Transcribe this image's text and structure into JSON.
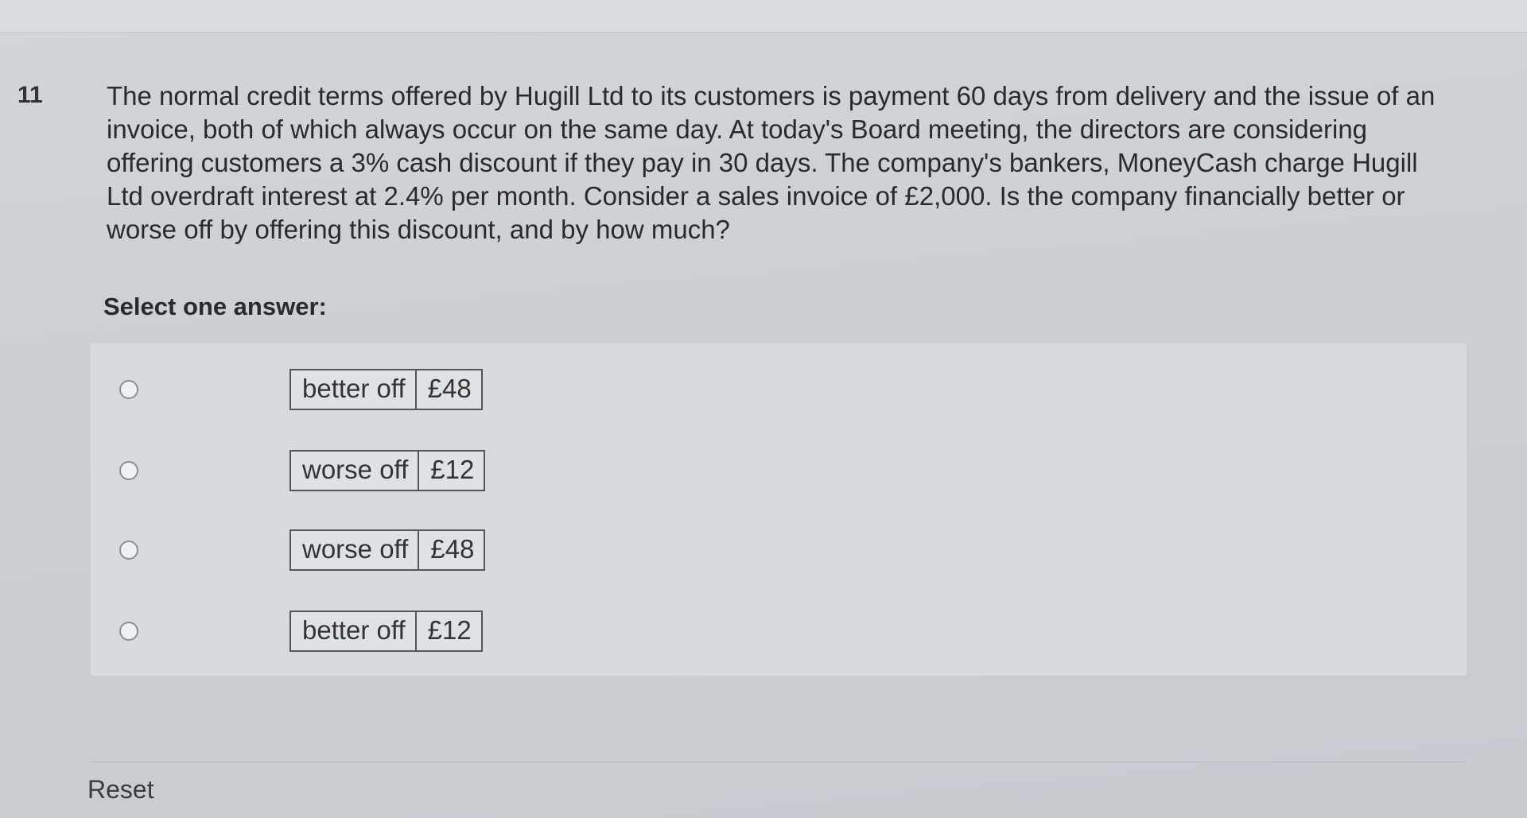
{
  "question": {
    "number": "11",
    "text": "The normal credit terms offered by Hugill Ltd to its customers is payment 60 days from delivery and the issue of an invoice, both of which always occur on the same day. At today's Board meeting, the directors are considering offering customers a 3% cash discount if they pay in 30 days. The company's bankers, MoneyCash charge Hugill Ltd overdraft interest at 2.4% per month. Consider a sales invoice of £2,000. Is the company financially better or worse off by offering this discount, and by how much?"
  },
  "prompt": "Select one answer:",
  "answers": [
    {
      "outcome": "better off",
      "amount": "£48"
    },
    {
      "outcome": "worse off",
      "amount": "£12"
    },
    {
      "outcome": "worse off",
      "amount": "£48"
    },
    {
      "outcome": "better off",
      "amount": "£12"
    }
  ],
  "reset_label": "Reset"
}
